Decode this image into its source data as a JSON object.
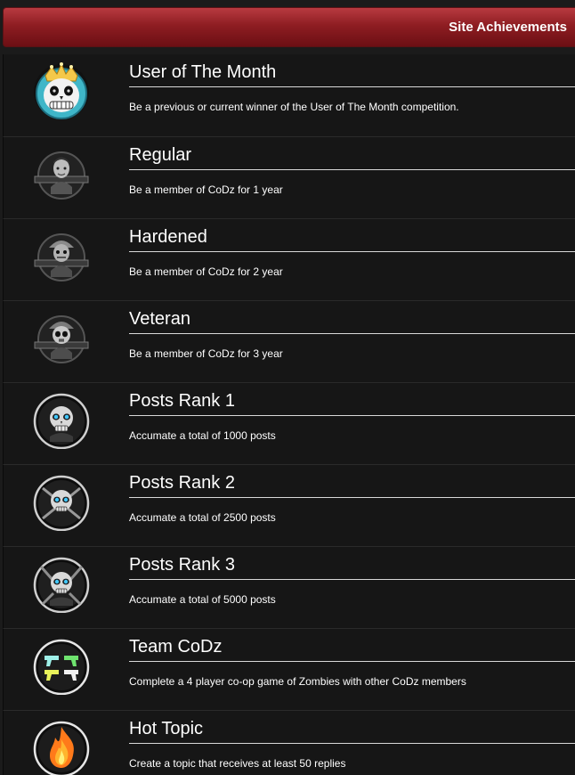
{
  "header": {
    "title": "Site Achievements"
  },
  "achievements": [
    {
      "title": "User of The Month",
      "description": "Be a previous or current winner of the User of The Month competition.",
      "icon": "king-skull-icon"
    },
    {
      "title": "Regular",
      "description": "Be a member of CoDz for 1 year",
      "icon": "soldier-emblem-icon"
    },
    {
      "title": "Hardened",
      "description": "Be a member of CoDz for 2 year",
      "icon": "soldier-cap-emblem-icon"
    },
    {
      "title": "Veteran",
      "description": "Be a member of CoDz for 3 year",
      "icon": "skull-soldier-emblem-icon"
    },
    {
      "title": "Posts Rank 1",
      "description": "Accumate a total of 1000 posts",
      "icon": "skull-rank1-icon"
    },
    {
      "title": "Posts Rank 2",
      "description": "Accumate a total of 2500 posts",
      "icon": "skull-rank2-icon"
    },
    {
      "title": "Posts Rank 3",
      "description": "Accumate a total of 5000 posts",
      "icon": "skull-rank3-icon"
    },
    {
      "title": "Team CoDz",
      "description": "Complete a 4 player co-op game of Zombies with other CoDz members",
      "icon": "pistols-icon"
    },
    {
      "title": "Hot Topic",
      "description": "Create a topic that receives at least 50 replies",
      "icon": "flame-icon"
    }
  ]
}
